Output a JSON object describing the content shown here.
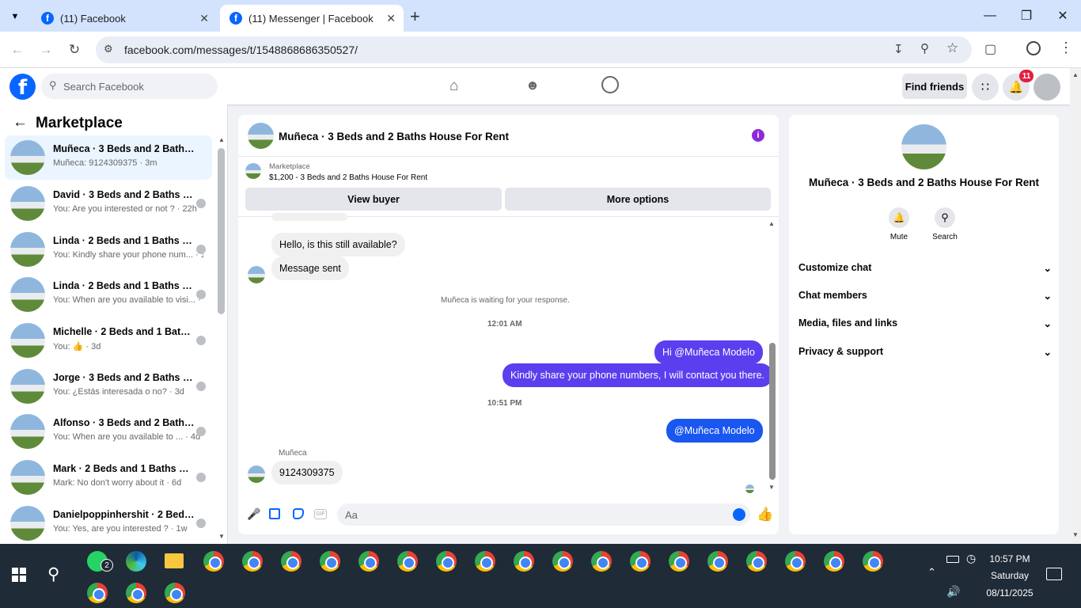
{
  "browser": {
    "tabs": [
      {
        "title": "(11) Facebook",
        "active": false
      },
      {
        "title": "(11) Messenger | Facebook",
        "active": true
      }
    ],
    "url": "facebook.com/messages/t/1548868686350527/"
  },
  "fb_header": {
    "logo": "f",
    "search_placeholder": "Search Facebook",
    "find_friends": "Find friends",
    "notification_count": "11"
  },
  "sidebar": {
    "title": "Marketplace",
    "conversations": [
      {
        "name": "Muñeca · 3 Beds and 2 Baths H...",
        "preview": "Muñeca: 9124309375 · 3m",
        "selected": true
      },
      {
        "name": "David · 3 Beds and 2 Baths H...",
        "preview": "You: Are you interested or not ? · 22h"
      },
      {
        "name": "Linda · 2 Beds and 1 Baths Hous...",
        "preview": "You: Kindly share your phone num... · 1d"
      },
      {
        "name": "Linda · 2 Beds and 1 Baths Hous...",
        "preview": "You: When are you available to visi... · 1d"
      },
      {
        "name": "Michelle · 2 Beds and 1 Baths H...",
        "preview": "You: 👍 · 3d"
      },
      {
        "name": "Jorge · 3 Beds and 2 Baths H...",
        "preview": "You: ¿Estás interesada o no? · 3d"
      },
      {
        "name": "Alfonso · 3 Beds and 2 Baths ...",
        "preview": "You: When are you available to ... · 4d"
      },
      {
        "name": "Mark · 2 Beds and 1 Baths Hous...",
        "preview": "Mark: No don't worry about it · 6d"
      },
      {
        "name": "Danielpoppinhershit · 2 Beds ...",
        "preview": "You: Yes, are you interested ? · 1w"
      }
    ]
  },
  "chat": {
    "title": "Muñeca · 3 Beds and 2 Baths House For Rent",
    "listing_label": "Marketplace",
    "listing_detail": "$1,200 - 3 Beds and 2 Baths House For Rent",
    "view_buyer": "View buyer",
    "more_options": "More options",
    "messages": {
      "in1": "Hello, is this still available?",
      "in2": "Message sent",
      "waiting": "Muñeca is waiting for your response.",
      "time1": "12:01 AM",
      "out1": "Hi @Muñeca Modelo",
      "out2": "Kindly share your phone numbers, I will contact you there.",
      "time2": "10:51 PM",
      "out3": "@Muñeca Modelo",
      "sender": "Muñeca",
      "in3": "9124309375"
    },
    "composer_placeholder": "Aa"
  },
  "info_panel": {
    "title": "Muñeca · 3 Beds and 2 Baths House For Rent",
    "mute": "Mute",
    "search": "Search",
    "sections": [
      "Customize chat",
      "Chat members",
      "Media, files and links",
      "Privacy & support"
    ]
  },
  "taskbar": {
    "whatsapp_badge": "2",
    "time": "10:57 PM",
    "day": "Saturday",
    "date": "08/11/2025"
  },
  "colors": {
    "fb_blue": "#0866ff",
    "messenger_purple": "#5b3fef",
    "taskbar": "#1f2b37"
  }
}
